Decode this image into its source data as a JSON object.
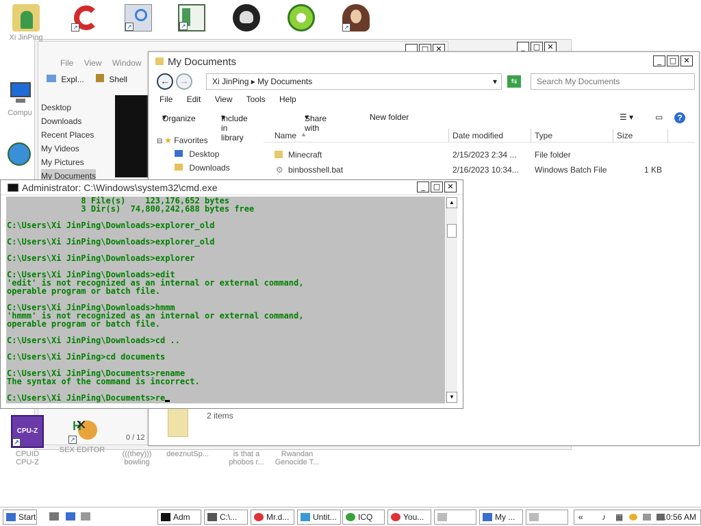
{
  "desktop_icons": [
    {
      "label": "Xi JinPing",
      "icon": "user-folder-icon"
    },
    {
      "label": "",
      "icon": "ccleaner-icon"
    },
    {
      "label": "",
      "icon": "computer-search-icon"
    },
    {
      "label": "",
      "icon": "window-app-icon"
    },
    {
      "label": "",
      "icon": "skull-icon"
    },
    {
      "label": "",
      "icon": "lime-icon"
    },
    {
      "label": "",
      "icon": "portrait-icon"
    },
    {
      "label": "Compu",
      "icon": "computer-icon"
    },
    {
      "label": "",
      "icon": "network-icon"
    },
    {
      "label": "CPUID CPU-Z",
      "icon": "cpuz-icon"
    },
    {
      "label": "SEX EDITOR",
      "icon": "hex-editor-icon"
    },
    {
      "label": "(((they))) bowling",
      "icon": "shortcut-icon"
    },
    {
      "label": "deeznutSp...",
      "icon": "shortcut-icon"
    },
    {
      "label": "is that a phobos r...",
      "icon": "shortcut-icon"
    },
    {
      "label": "Rwandan Genocide T...",
      "icon": "shortcut-icon"
    }
  ],
  "back_window": {
    "menu": [
      "File",
      "View",
      "Window"
    ],
    "toolbar": [
      "Expl...",
      "Shell"
    ],
    "nav_items": [
      "Desktop",
      "Downloads",
      "Recent Places",
      "My Videos",
      "My Pictures",
      "My Documents"
    ],
    "status": "0 / 12"
  },
  "explorer": {
    "title": "My Documents",
    "breadcrumb": [
      "Xi JinPing",
      "My Documents"
    ],
    "search_placeholder": "Search My Documents",
    "menu": [
      "File",
      "Edit",
      "View",
      "Tools",
      "Help"
    ],
    "commands": [
      "Organize",
      "Include in library",
      "Share with",
      "New folder"
    ],
    "nav": {
      "favorites": "Favorites",
      "items": [
        "Desktop",
        "Downloads"
      ]
    },
    "columns": [
      "Name",
      "Date modified",
      "Type",
      "Size"
    ],
    "files": [
      {
        "name": "Minecraft",
        "date": "2/15/2023 2:34 ...",
        "type": "File folder",
        "size": ""
      },
      {
        "name": "binbosshell.bat",
        "date": "2/16/2023 10:34...",
        "type": "Windows Batch File",
        "size": "1 KB"
      }
    ],
    "item_count": "2 items"
  },
  "cmd": {
    "title": "Administrator: C:\\Windows\\system32\\cmd.exe",
    "lines": [
      "               8 File(s)    123,176,652 bytes",
      "               3 Dir(s)  74,800,242,688 bytes free",
      "",
      "C:\\Users\\Xi JinPing\\Downloads>explorer_old",
      "",
      "C:\\Users\\Xi JinPing\\Downloads>explorer_old",
      "",
      "C:\\Users\\Xi JinPing\\Downloads>explorer",
      "",
      "C:\\Users\\Xi JinPing\\Downloads>edit",
      "'edit' is not recognized as an internal or external command,",
      "operable program or batch file.",
      "",
      "C:\\Users\\Xi JinPing\\Downloads>hmmm",
      "'hmmm' is not recognized as an internal or external command,",
      "operable program or batch file.",
      "",
      "C:\\Users\\Xi JinPing\\Downloads>cd ..",
      "",
      "C:\\Users\\Xi JinPing>cd documents",
      "",
      "C:\\Users\\Xi JinPing\\Documents>rename",
      "The syntax of the command is incorrect.",
      "",
      "C:\\Users\\Xi JinPing\\Documents>re"
    ]
  },
  "taskbar": {
    "start": "Start",
    "buttons": [
      "Adm",
      "C:\\...",
      "Mr.d...",
      "Untit...",
      "ICQ",
      "You...",
      "",
      "My ...",
      ""
    ],
    "clock": "10:56 AM"
  }
}
